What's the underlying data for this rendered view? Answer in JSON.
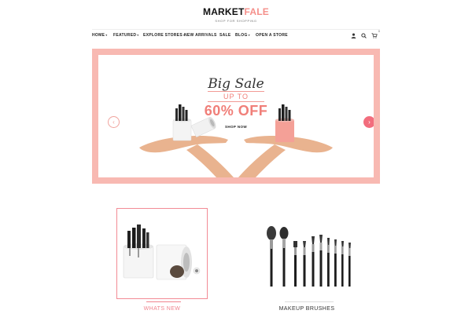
{
  "brand": {
    "name_part1": "MARKET",
    "name_part2": "FALE",
    "tagline": "SHOP FOR SHOPPING",
    "accent_color": "#f58f8a"
  },
  "nav": {
    "items": [
      {
        "label": "HOME",
        "has_dropdown": true
      },
      {
        "label": "FEATURED",
        "has_dropdown": true
      },
      {
        "label": "EXPLORE STORES",
        "has_dropdown": true
      },
      {
        "label": "NEW ARRIVALS",
        "has_dropdown": false
      },
      {
        "label": "SALE",
        "has_dropdown": false
      },
      {
        "label": "BLOG",
        "has_dropdown": true
      },
      {
        "label": "OPEN A STORE",
        "has_dropdown": false
      }
    ],
    "caret": "▾",
    "icons": [
      "user-icon",
      "search-icon",
      "cart-icon"
    ],
    "cart_count": "0"
  },
  "hero": {
    "script_title": "Big Sale",
    "subtitle": "UP TO",
    "headline": "60% OFF",
    "cta": "SHOP NOW",
    "prev_arrow": "‹",
    "next_arrow": "›",
    "border_color": "#f8b9b2",
    "headline_color": "#f07f79"
  },
  "categories": [
    {
      "label": "WHATS NEW",
      "selected": true,
      "color": "#f0858f"
    },
    {
      "label": "MAKEUP BRUSHES",
      "selected": false,
      "color": "#333333"
    }
  ]
}
